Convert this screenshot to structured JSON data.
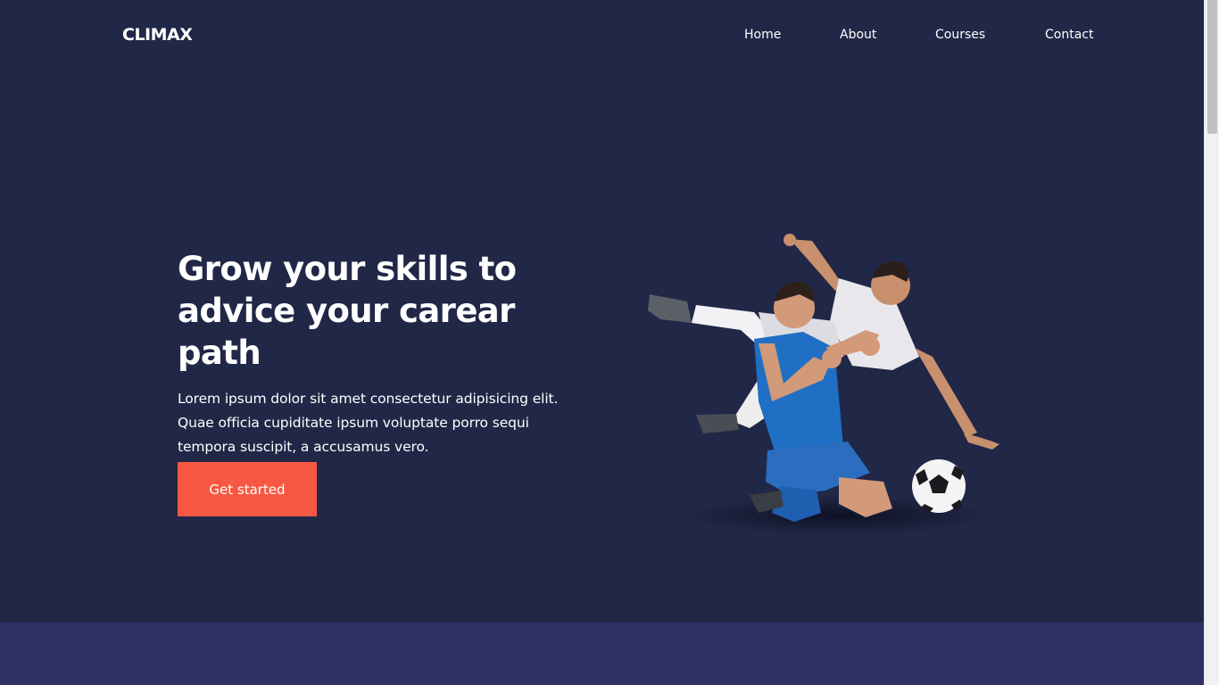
{
  "header": {
    "logo": "CLIMAX",
    "nav": [
      {
        "label": "Home"
      },
      {
        "label": "About"
      },
      {
        "label": "Courses"
      },
      {
        "label": "Contact"
      }
    ]
  },
  "hero": {
    "title": "Grow your skills to advice your carear path",
    "text": "Lorem ipsum dolor sit amet consectetur adipisicing elit. Quae officia cupiditate ipsum voluptate porro sequi tempora suscipit, a accusamus vero.",
    "cta_label": "Get started",
    "image_alt": "soccer-players-illustration"
  },
  "colors": {
    "background": "#212746",
    "accent": "#f75843",
    "band": "#2e3166"
  }
}
